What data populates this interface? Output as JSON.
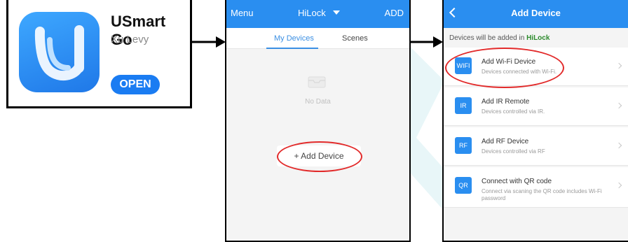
{
  "app_card": {
    "name": "USmart Go",
    "developer": "Xu Levy",
    "open_label": "OPEN",
    "icon": "usmart-logo-icon"
  },
  "screen_devices": {
    "menu_label": "Menu",
    "home_name": "HiLock",
    "add_label": "ADD",
    "tabs": [
      {
        "label": "My Devices",
        "active": true
      },
      {
        "label": "Scenes",
        "active": false
      }
    ],
    "empty_text": "No Data",
    "add_device_label": "+ Add Device"
  },
  "screen_add": {
    "title": "Add Device",
    "hint_prefix": "Devices will be added in",
    "hint_home": "HiLock",
    "options": [
      {
        "badge": "WIFI",
        "title": "Add Wi-Fi Device",
        "subtitle": "Devices connected with Wi-Fi."
      },
      {
        "badge": "IR",
        "title": "Add IR Remote",
        "subtitle": "Devices controlled via IR."
      },
      {
        "badge": "RF",
        "title": "Add RF Device",
        "subtitle": "Devices controlled via RF"
      },
      {
        "badge": "QR",
        "title": "Connect with QR code",
        "subtitle": "Connect via scaning the QR code includes Wi-Fi password"
      }
    ]
  },
  "colors": {
    "accent": "#2a8ef0",
    "highlight": "#e22a2a",
    "home_green": "#2c8a2c"
  }
}
